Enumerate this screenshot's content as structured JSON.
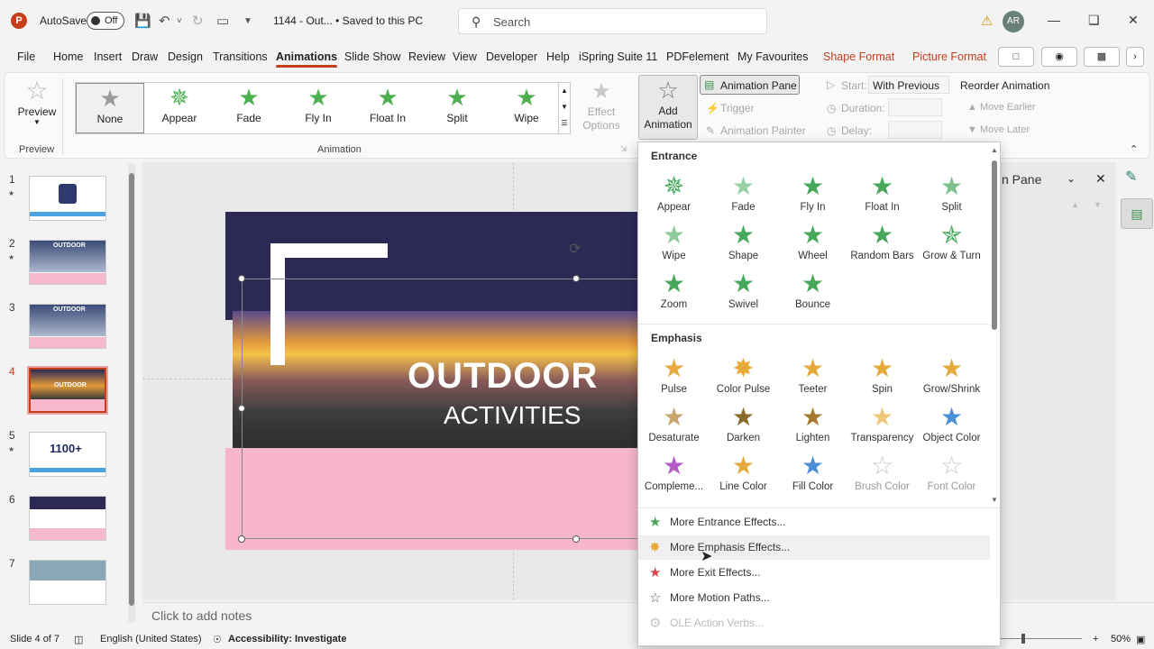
{
  "titlebar": {
    "logo": "P",
    "autosave_label": "AutoSave",
    "autosave_state": "Off",
    "doc_title": "1144 - Out...  •  Saved to this PC",
    "search_placeholder": "Search",
    "avatar_initials": "AR"
  },
  "tabs": [
    "File",
    "Home",
    "Insert",
    "Draw",
    "Design",
    "Transitions",
    "Animations",
    "Slide Show",
    "Review",
    "View",
    "Developer",
    "Help",
    "iSpring Suite 11",
    "PDFelement",
    "My Favourites",
    "Shape Format",
    "Picture Format"
  ],
  "ribbon": {
    "preview_label": "Preview",
    "preview_group": "Preview",
    "animation_group": "Animation",
    "gallery": [
      "None",
      "Appear",
      "Fade",
      "Fly In",
      "Float In",
      "Split",
      "Wipe"
    ],
    "effect_options": "Effect Options",
    "add_animation": "Add Animation",
    "animation_pane": "Animation Pane",
    "trigger": "Trigger",
    "animation_painter": "Animation Painter",
    "start_label": "Start:",
    "start_value": "With Previous",
    "duration_label": "Duration:",
    "delay_label": "Delay:",
    "reorder": "Reorder Animation",
    "move_earlier": "Move Earlier",
    "move_later": "Move Later"
  },
  "slides": [
    {
      "num": "1",
      "star": true
    },
    {
      "num": "2",
      "star": true
    },
    {
      "num": "3",
      "star": false
    },
    {
      "num": "4",
      "star": false,
      "selected": true
    },
    {
      "num": "5",
      "star": true
    },
    {
      "num": "6",
      "star": false
    },
    {
      "num": "7",
      "star": false
    }
  ],
  "thumbs": {
    "s2": "OUTDOOR",
    "s3": "OUTDOOR",
    "s4": "OUTDOOR",
    "s5": "1100+"
  },
  "slide": {
    "title": "OUTDOOR",
    "subtitle": "ACTIVITIES"
  },
  "pane_title": "n Pane",
  "notes": "Click to add notes",
  "status": {
    "slide": "Slide 4 of 7",
    "language": "English (United States)",
    "accessibility": "Accessibility: Investigate",
    "zoom": "50%"
  },
  "dropdown": {
    "entrance_title": "Entrance",
    "entrance": [
      "Appear",
      "Fade",
      "Fly In",
      "Float In",
      "Split",
      "Wipe",
      "Shape",
      "Wheel",
      "Random Bars",
      "Grow & Turn",
      "Zoom",
      "Swivel",
      "Bounce"
    ],
    "emphasis_title": "Emphasis",
    "emphasis": [
      "Pulse",
      "Color Pulse",
      "Teeter",
      "Spin",
      "Grow/Shrink",
      "Desaturate",
      "Darken",
      "Lighten",
      "Transparency",
      "Object Color",
      "Compleme...",
      "Line Color",
      "Fill Color",
      "Brush Color",
      "Font Color"
    ],
    "more": [
      "More Entrance Effects...",
      "More Emphasis Effects...",
      "More Exit Effects...",
      "More Motion Paths...",
      "OLE Action Verbs..."
    ]
  },
  "colors": {
    "accent": "#c43e1c",
    "entrance": "#45a85a",
    "emphasis": "#e6a93b",
    "exit": "#d9434b"
  }
}
